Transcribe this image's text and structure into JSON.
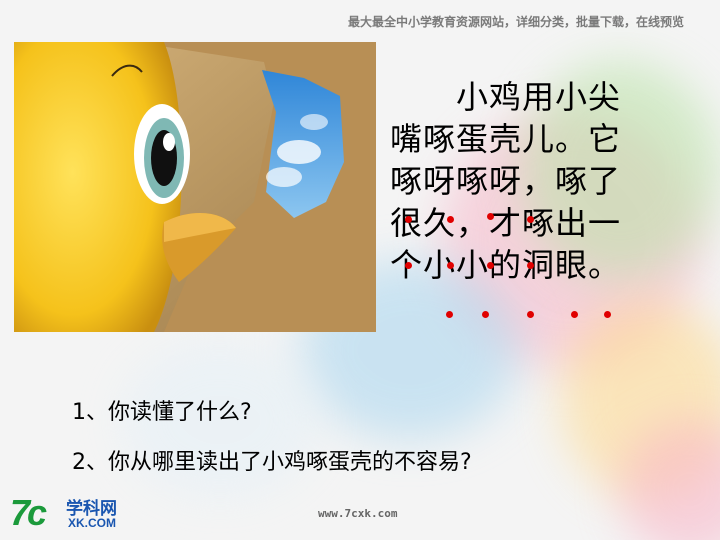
{
  "header": {
    "text": "最大最全中小学教育资源网站，详细分类，批量下载，在线预览"
  },
  "poem": {
    "lines": [
      "　　小鸡用小尖",
      "嘴啄蛋壳儿。它",
      "啄呀啄呀，啄了",
      "很久，才啄出一",
      "个小小的洞眼。"
    ]
  },
  "questions": [
    "1、你读懂了什么?",
    "2、你从哪里读出了小鸡啄蛋壳的不容易?"
  ],
  "logo": {
    "mark": "7c",
    "name": "学科网",
    "domain": "XK.COM"
  },
  "footer": {
    "url": "www.7cxk.com"
  },
  "colors": {
    "emphasis_dots": "#e00000",
    "logo_green": "#1b9a3b",
    "logo_blue": "#1a56b0"
  }
}
